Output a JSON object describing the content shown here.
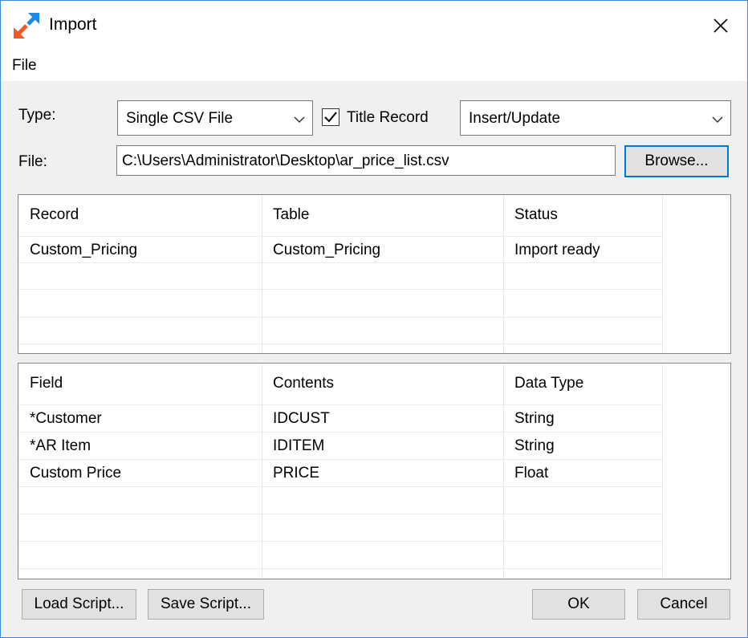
{
  "window": {
    "title": "Import",
    "close_glyph": "✕"
  },
  "menu": {
    "file_label": "File"
  },
  "form": {
    "type_label": "Type:",
    "type_value": "Single CSV File",
    "title_record_label": "Title Record",
    "title_record_checked": true,
    "mode_value": "Insert/Update",
    "file_label": "File:",
    "file_path": "C:\\Users\\Administrator\\Desktop\\ar_price_list.csv",
    "browse_label": "Browse..."
  },
  "records_table": {
    "headers": [
      "Record",
      "Table",
      "Status"
    ],
    "rows": [
      [
        "Custom_Pricing",
        "Custom_Pricing",
        "Import ready"
      ]
    ]
  },
  "fields_table": {
    "headers": [
      "Field",
      "Contents",
      "Data Type"
    ],
    "rows": [
      [
        "*Customer",
        "IDCUST",
        "String"
      ],
      [
        "*AR Item",
        "IDITEM",
        "String"
      ],
      [
        "Custom Price",
        "PRICE",
        "Float"
      ]
    ]
  },
  "footer": {
    "load_script_label": "Load Script...",
    "save_script_label": "Save Script...",
    "ok_label": "OK",
    "cancel_label": "Cancel"
  },
  "icons": {
    "app": "import-arrows-icon",
    "close": "close-icon",
    "dropdown": "chevron-down-icon",
    "check": "checkmark-icon"
  },
  "colors": {
    "window_border": "#3b8ad8",
    "icon_orange": "#f05a22",
    "icon_blue": "#1e88e5",
    "default_button_border": "#0078d7"
  }
}
